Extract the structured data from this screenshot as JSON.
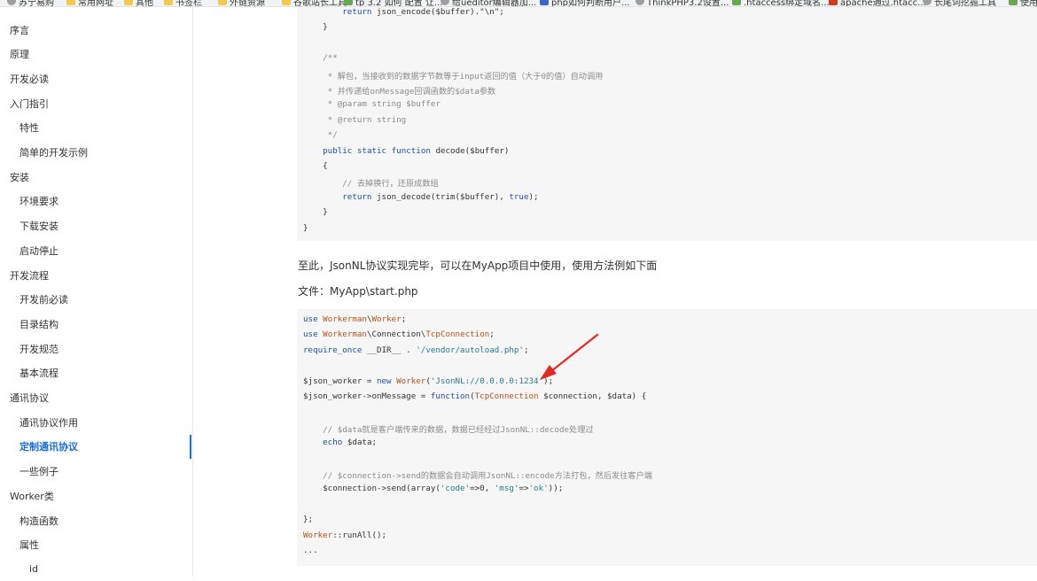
{
  "bookmarks": [
    {
      "label": "苏宁易购",
      "icon": "globe-icon"
    },
    {
      "label": "常用网址",
      "icon": "folder-icon"
    },
    {
      "label": "其他",
      "icon": "folder-icon"
    },
    {
      "label": "书签栏",
      "icon": "folder-icon"
    },
    {
      "label": "外链资源",
      "icon": "folder-icon"
    },
    {
      "label": "谷歌站长工具",
      "icon": "folder-icon"
    },
    {
      "label": "tp 3.2 如何 配置 让...",
      "icon": "page-icon"
    },
    {
      "label": "给ueditor编辑器加...",
      "icon": "search-icon"
    },
    {
      "label": "php如何判断用户...",
      "icon": "baidu-icon"
    },
    {
      "label": "ThinkPHP3.2设置...",
      "icon": "search-icon"
    },
    {
      "label": ".htaccess绑定域名...",
      "icon": "page-icon"
    },
    {
      "label": "apache通过.htacc...",
      "icon": "csdn-icon"
    },
    {
      "label": "长尾词挖掘工具",
      "icon": "globe-icon"
    },
    {
      "label": "使用",
      "icon": "page-icon"
    }
  ],
  "sidebar": {
    "items": [
      {
        "label": "序言",
        "level": 1
      },
      {
        "label": "原理",
        "level": 1
      },
      {
        "label": "开发必读",
        "level": 1
      },
      {
        "label": "入门指引",
        "level": 1
      },
      {
        "label": "特性",
        "level": 2
      },
      {
        "label": "简单的开发示例",
        "level": 2
      },
      {
        "label": "安装",
        "level": 1
      },
      {
        "label": "环境要求",
        "level": 2
      },
      {
        "label": "下载安装",
        "level": 2
      },
      {
        "label": "启动停止",
        "level": 2
      },
      {
        "label": "开发流程",
        "level": 1
      },
      {
        "label": "开发前必读",
        "level": 2
      },
      {
        "label": "目录结构",
        "level": 2
      },
      {
        "label": "开发规范",
        "level": 2
      },
      {
        "label": "基本流程",
        "level": 2
      },
      {
        "label": "通讯协议",
        "level": 1
      },
      {
        "label": "通讯协议作用",
        "level": 2
      },
      {
        "label": "定制通讯协议",
        "level": 2,
        "active": true
      },
      {
        "label": "一些例子",
        "level": 2
      },
      {
        "label": "Worker类",
        "level": 1
      },
      {
        "label": "构造函数",
        "level": 2
      },
      {
        "label": "属性",
        "level": 2
      },
      {
        "label": "id",
        "level": 3
      }
    ]
  },
  "content": {
    "code1": [
      "        return json_encode($buffer).\"\\n\";",
      "    }",
      "",
      "    /**",
      "     * 解包，当接收到的数据字节数等于input返回的值（大于0的值）自动调用",
      "     * 并传递给onMessage回调函数的$data参数",
      "     * @param string $buffer",
      "     * @return string",
      "     */",
      "    public static function decode($buffer)",
      "    {",
      "        // 去掉换行，还原成数组",
      "        return json_decode(trim($buffer), true);",
      "    }",
      "}"
    ],
    "para1": "至此，JsonNL协议实现完毕，可以在MyApp项目中使用，使用方法例如下面",
    "para2": "文件：MyApp\\start.php",
    "code2": [
      "use Workerman\\Worker;",
      "use Workerman\\Connection\\TcpConnection;",
      "require_once __DIR__ . '/vendor/autoload.php';",
      "",
      "$json_worker = new Worker('JsonNL://0.0.0.0:1234');",
      "$json_worker->onMessage = function(TcpConnection $connection, $data) {",
      "",
      "    // $data就是客户端传来的数据，数据已经经过JsonNL::decode处理过",
      "    echo $data;",
      "",
      "    // $connection->send的数据会自动调用JsonNL::encode方法打包，然后发往客户端",
      "    $connection->send(array('code'=>0, 'msg'=>'ok'));",
      "",
      "};",
      "Worker::runAll();",
      "..."
    ]
  },
  "annotation": {
    "color": "#e8281e",
    "icon": "red-arrow-annotation"
  }
}
